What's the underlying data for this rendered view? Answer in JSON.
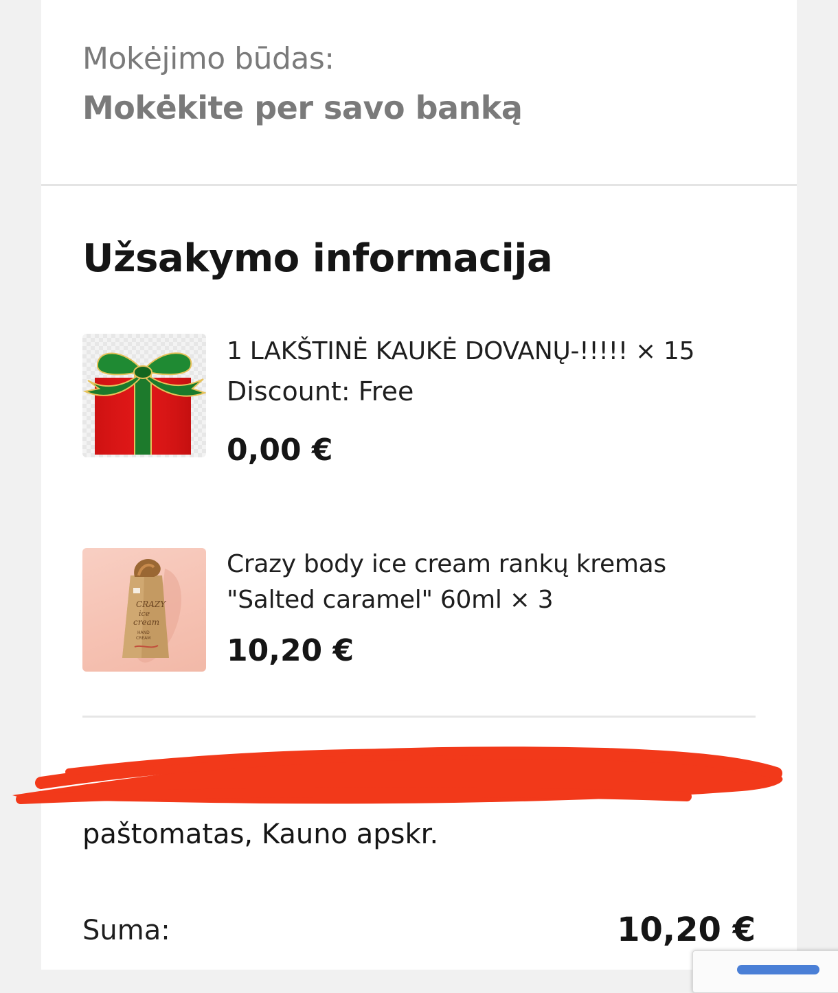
{
  "payment": {
    "label": "Mokėjimo būdas:",
    "value": "Mokėkite per savo banką"
  },
  "order": {
    "title": "Užsakymo informacija",
    "items": [
      {
        "name": "1 LAKŠTINĖ KAUKĖ DOVANŲ-!!!!! × 15",
        "discount": "Discount: Free",
        "price": "0,00 €",
        "image_icon": "gift-box-image"
      },
      {
        "name": "Crazy body ice cream rankų kremas \"Salted caramel\" 60ml × 3",
        "price": "10,20 €",
        "image_icon": "hand-cream-tube-image",
        "image_text": "CRAZY ice cream HAND CREAM"
      }
    ],
    "shipping": "paštomatas, Kauno apskr.",
    "sum_label": "Suma:",
    "sum_value": "10,20 €"
  },
  "colors": {
    "background": "#f1f1f1",
    "card": "#ffffff",
    "muted_text": "#7a7a7a",
    "text": "#151515",
    "redaction": "#f2391a"
  }
}
